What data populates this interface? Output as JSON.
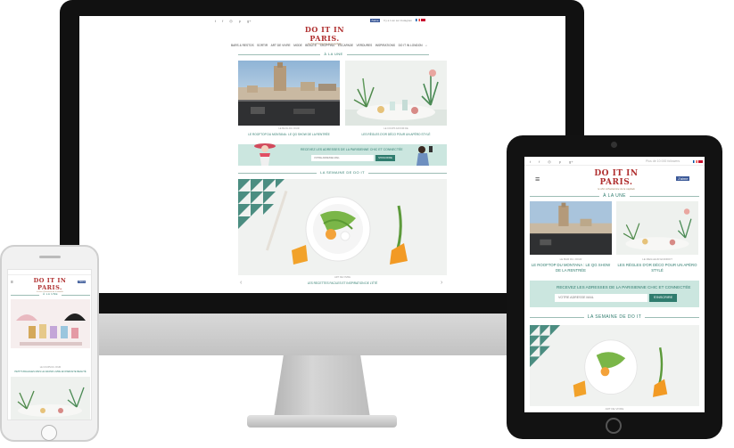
{
  "brand": {
    "logo": "DO IT IN PARIS.",
    "tagline": "le chic à Parisienne de la capitale"
  },
  "colors": {
    "accent": "#2f7c6e",
    "newsletter_bg": "#cbe6df",
    "facebook": "#3b5998",
    "logo": "#b03030"
  },
  "desktop": {
    "social_icons": [
      "twitter-icon",
      "facebook-icon",
      "instagram-icon",
      "pinterest-icon",
      "google-plus-icon"
    ],
    "social_glyphs": [
      "t",
      "f",
      "◎",
      "p",
      "g+"
    ],
    "like_label": "J'aime",
    "country_text": "Il y a 1 an sur Instagram",
    "nav": [
      "BARS & RESTOS",
      "SORTIR",
      "ART DE VIVRE",
      "MODE",
      "BEAUTÉ",
      "SHOPPING",
      "ESCAPADE",
      "VERDURES",
      "INSPIRATIONS",
      "DO IT IN LONDON"
    ],
    "search_glyph": "⌕",
    "section_a_la_une": "À LA UNE",
    "article1": {
      "category": "LE BLOG DU JOUR",
      "title": "LE ROOFTOP DU MONTANA : LE QG SHOW DE LA RENTRÉE"
    },
    "article2": {
      "category": "LE COUPS FAVORI DE",
      "title": "LES RÈGLES D'OR DÉCO POUR UN APÉRO STYLÉ"
    },
    "newsletter": {
      "text": "RECEVEZ LES ADRESSES DE LA PARISIENNE CHIC ET CONNECTÉE",
      "placeholder": "VOTRE ADRESSE MAIL",
      "button": "S'INSCRIRE"
    },
    "section_semaine": "LA SEMAINE DE DO IT",
    "hero": {
      "category": "ART DE VIVRE",
      "title": "LES RECETTES FACILES ET INSPIRATION DE L'ÉTÉ"
    },
    "arrow_left": "‹",
    "arrow_right": "›"
  },
  "tablet": {
    "social_glyphs": [
      "t",
      "f",
      "◎",
      "p",
      "g+"
    ],
    "country_text": "Plus de 10 000 followers",
    "menu_glyph": "≡",
    "like_label": "J'aime",
    "section_a_la_une": "À LA UNE",
    "article1": {
      "category": "LE BAR DU JOUR",
      "title": "LE ROOFTOP DU MONTANA : LE QG SHOW DE LA RENTRÉE"
    },
    "article2": {
      "category": "LE MEILLEUR ENDROIT",
      "title": "LES RÈGLES D'OR DÉCO POUR UN APÉRO STYLÉ"
    },
    "newsletter": {
      "text": "RECEVEZ LES ADRESSES DE LA PARISIENNE CHIC ET CONNECTÉE",
      "placeholder": "VOTRE ADRESSE MAIL",
      "button": "S'INSCRIRE"
    },
    "section_semaine": "LA SEMAINE DE DO IT",
    "hero_category": "ART DE VIVRE"
  },
  "phone": {
    "menu_glyph": "≡",
    "like_label": "J'aime",
    "section_a_la_une": "À LA UNE",
    "article": {
      "category": "LE COUPS DU JOUR",
      "title": "PETITS BAGAGES MAIS LE GRAND LIVRE EN PARFAITE BEAUTÉ"
    }
  }
}
